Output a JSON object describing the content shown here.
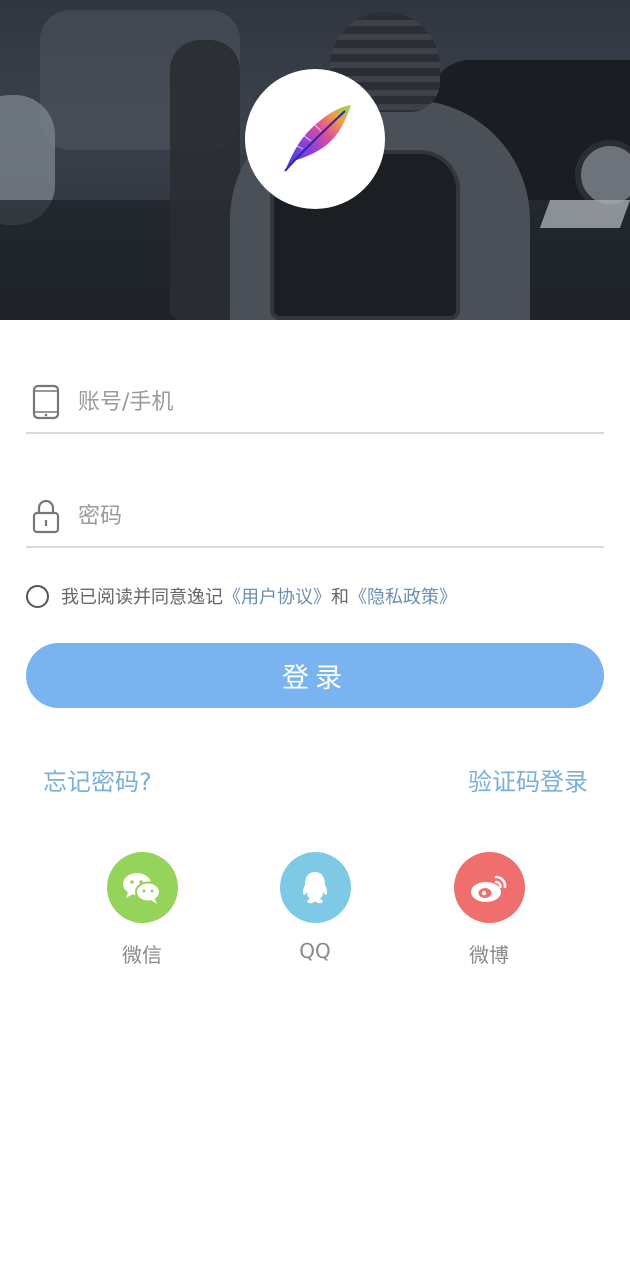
{
  "header": {
    "logo_icon": "feather-logo-icon"
  },
  "form": {
    "account_placeholder": "账号/手机",
    "account_icon": "phone-icon",
    "password_placeholder": "密码",
    "password_icon": "lock-icon"
  },
  "agreement": {
    "prefix": "我已阅读并同意逸记",
    "user_agreement": "《用户协议》",
    "joiner": "和",
    "privacy_policy": "《隐私政策》"
  },
  "login_button": "登录",
  "links": {
    "forgot_password": "忘记密码?",
    "sms_login": "验证码登录"
  },
  "social": [
    {
      "label": "微信",
      "icon": "wechat-icon",
      "color": "#95d35a"
    },
    {
      "label": "QQ",
      "icon": "qq-icon",
      "color": "#7ec9e6"
    },
    {
      "label": "微博",
      "icon": "weibo-icon",
      "color": "#ef6f6f"
    }
  ],
  "colors": {
    "primary_button": "#7ab4f0",
    "link": "#7ab0d9",
    "agreement_link": "#6c8fb0"
  }
}
